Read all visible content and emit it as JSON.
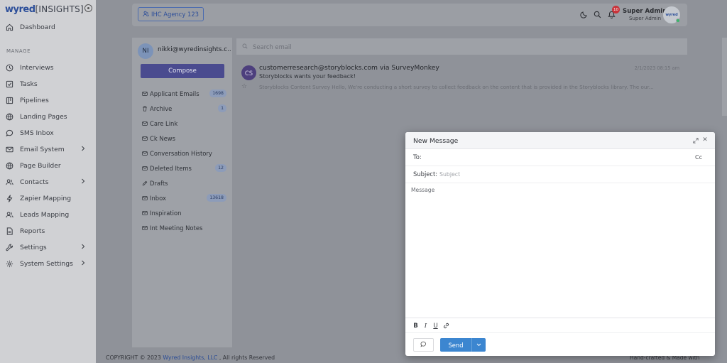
{
  "app": {
    "brand": "wyred",
    "product": "[INSIGHTS]"
  },
  "sidebar": {
    "dashboard": "Dashboard",
    "section_label": "MANAGE",
    "items": [
      {
        "label": "Interviews"
      },
      {
        "label": "Tasks"
      },
      {
        "label": "Pipelines"
      },
      {
        "label": "Landing Pages"
      },
      {
        "label": "SMS Inbox"
      },
      {
        "label": "Email System"
      },
      {
        "label": "Page Builder"
      },
      {
        "label": "Contacts"
      },
      {
        "label": "Zapier Mapping"
      },
      {
        "label": "Leads Mapping"
      },
      {
        "label": "Reports"
      },
      {
        "label": "Settings"
      },
      {
        "label": "System Settings"
      }
    ]
  },
  "topbar": {
    "agency": "IHC Agency 123",
    "notification_count": "10",
    "user_name": "Super Admin",
    "user_role": "Super Admin",
    "avatar_text": "wyred"
  },
  "mail": {
    "account_initials": "NI",
    "account_email": "nikki@wyredinsights.c...",
    "compose_label": "Compose",
    "folders": [
      {
        "label": "Applicant Emails",
        "count": "1698"
      },
      {
        "label": "Archive",
        "count": "1"
      },
      {
        "label": "Care Link",
        "count": ""
      },
      {
        "label": "Ck News",
        "count": ""
      },
      {
        "label": "Conversation History",
        "count": ""
      },
      {
        "label": "Deleted Items",
        "count": "12"
      },
      {
        "label": "Drafts",
        "count": ""
      },
      {
        "label": "Inbox",
        "count": "13618"
      },
      {
        "label": "Inspiration",
        "count": ""
      },
      {
        "label": "Int Meeting Notes",
        "count": ""
      }
    ],
    "search_placeholder": "Search email",
    "emails": [
      {
        "initials": "CS",
        "from": "customerresearch@storyblocks.com via SurveyMonkey",
        "date": "2/1/2023 08:15 am",
        "subject": "Storyblocks wants your feedback!",
        "preview": "Storyblocks Content Survey Hello, We're conducting a short survey to collect feedback on the content that is provided in the Storyblocks library. The our..."
      }
    ]
  },
  "footer": {
    "copyright": "COPYRIGHT © 2023",
    "company": "Wyred Insights, LLC",
    "rights": ", All rights Reserved",
    "right_text": "Hand-crafted & Made with"
  },
  "modal": {
    "title": "New Message",
    "to_label": "To:",
    "cc_label": "Cc",
    "subject_label": "Subject:",
    "subject_placeholder": "Subject",
    "message_placeholder": "Message",
    "send_label": "Send"
  },
  "colors": {
    "accent": "#3c86d0",
    "compose": "#4a4b8f",
    "badge": "#c9333a"
  }
}
